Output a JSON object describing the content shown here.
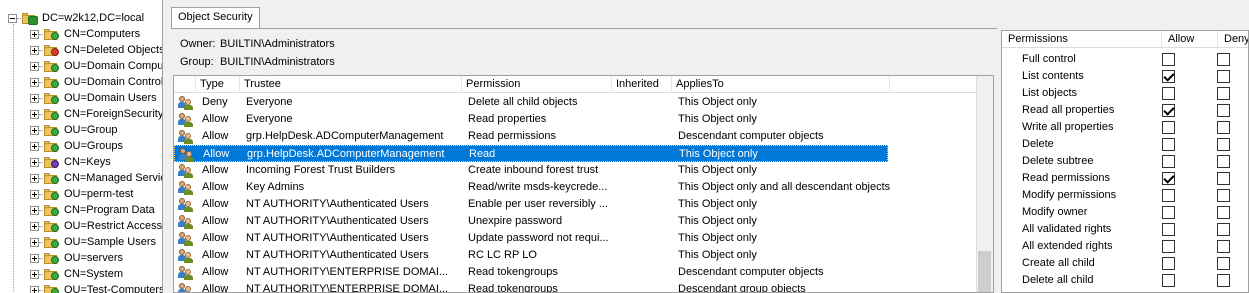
{
  "tree": {
    "root": "DC=w2k12,DC=local",
    "nodes": [
      {
        "label": "CN=Computers",
        "badge": "green"
      },
      {
        "label": "CN=Deleted Objects",
        "badge": "red"
      },
      {
        "label": "OU=Domain Comput",
        "badge": "green"
      },
      {
        "label": "OU=Domain Controlle",
        "badge": "green"
      },
      {
        "label": "OU=Domain Users",
        "badge": "green"
      },
      {
        "label": "CN=ForeignSecurityP",
        "badge": "green"
      },
      {
        "label": "OU=Group",
        "badge": "green"
      },
      {
        "label": "OU=Groups",
        "badge": "green"
      },
      {
        "label": "CN=Keys",
        "badge": "purple"
      },
      {
        "label": "CN=Managed Servic",
        "badge": "green"
      },
      {
        "label": "OU=perm-test",
        "badge": "green"
      },
      {
        "label": "CN=Program Data",
        "badge": "green"
      },
      {
        "label": "OU=Restrict Access",
        "badge": "green"
      },
      {
        "label": "OU=Sample Users",
        "badge": "green"
      },
      {
        "label": "OU=servers",
        "badge": "green"
      },
      {
        "label": "CN=System",
        "badge": "green"
      },
      {
        "label": "OU=Test-Computers",
        "badge": "green"
      }
    ]
  },
  "tab": "Object Security",
  "owner": {
    "label": "Owner:",
    "value": "BUILTIN\\Administrators"
  },
  "group": {
    "label": "Group:",
    "value": "BUILTIN\\Administrators"
  },
  "grid": {
    "columns": [
      "Type",
      "Trustee",
      "Permission",
      "Inherited",
      "AppliesTo"
    ],
    "rows": [
      {
        "type": "Deny",
        "trustee": "Everyone",
        "permission": "Delete all child objects",
        "inherited": "",
        "applies": "This Object only"
      },
      {
        "type": "Allow",
        "trustee": "Everyone",
        "permission": "Read properties",
        "inherited": "",
        "applies": "This Object only"
      },
      {
        "type": "Allow",
        "trustee": "grp.HelpDesk.ADComputerManagement",
        "permission": "Read permissions",
        "inherited": "",
        "applies": "Descendant computer objects"
      },
      {
        "type": "Allow",
        "trustee": "grp.HelpDesk.ADComputerManagement",
        "permission": "Read",
        "inherited": "",
        "applies": "This Object only",
        "selected": true
      },
      {
        "type": "Allow",
        "trustee": "Incoming Forest Trust Builders",
        "permission": "Create inbound forest trust",
        "inherited": "",
        "applies": "This Object only"
      },
      {
        "type": "Allow",
        "trustee": "Key Admins",
        "permission": "Read/write msds-keycrede...",
        "inherited": "",
        "applies": "This Object only and all descendant objects"
      },
      {
        "type": "Allow",
        "trustee": "NT AUTHORITY\\Authenticated Users",
        "permission": "Enable per user reversibly ...",
        "inherited": "",
        "applies": "This Object only"
      },
      {
        "type": "Allow",
        "trustee": "NT AUTHORITY\\Authenticated Users",
        "permission": "Unexpire password",
        "inherited": "",
        "applies": "This Object only"
      },
      {
        "type": "Allow",
        "trustee": "NT AUTHORITY\\Authenticated Users",
        "permission": "Update password not requi...",
        "inherited": "",
        "applies": "This Object only"
      },
      {
        "type": "Allow",
        "trustee": "NT AUTHORITY\\Authenticated Users",
        "permission": "RC LC RP LO",
        "inherited": "",
        "applies": "This Object only"
      },
      {
        "type": "Allow",
        "trustee": "NT AUTHORITY\\ENTERPRISE DOMAI...",
        "permission": "Read tokengroups",
        "inherited": "",
        "applies": "Descendant computer objects"
      },
      {
        "type": "Allow",
        "trustee": "NT AUTHORITY\\ENTERPRISE DOMAI...",
        "permission": "Read tokengroups",
        "inherited": "",
        "applies": "Descendant group objects"
      }
    ]
  },
  "permissions": {
    "columns": [
      "Permissions",
      "Allow",
      "Deny"
    ],
    "rows": [
      {
        "name": "Full control",
        "allow": false,
        "deny": false
      },
      {
        "name": "List contents",
        "allow": true,
        "deny": false
      },
      {
        "name": "List objects",
        "allow": false,
        "deny": false
      },
      {
        "name": "Read all properties",
        "allow": true,
        "deny": false
      },
      {
        "name": "Write all properties",
        "allow": false,
        "deny": false
      },
      {
        "name": "Delete",
        "allow": false,
        "deny": false
      },
      {
        "name": "Delete subtree",
        "allow": false,
        "deny": false
      },
      {
        "name": "Read permissions",
        "allow": true,
        "deny": false
      },
      {
        "name": "Modify permissions",
        "allow": false,
        "deny": false
      },
      {
        "name": "Modify owner",
        "allow": false,
        "deny": false
      },
      {
        "name": "All validated rights",
        "allow": false,
        "deny": false
      },
      {
        "name": "All extended rights",
        "allow": false,
        "deny": false
      },
      {
        "name": "Create all child",
        "allow": false,
        "deny": false
      },
      {
        "name": "Delete all child",
        "allow": false,
        "deny": false
      }
    ]
  }
}
